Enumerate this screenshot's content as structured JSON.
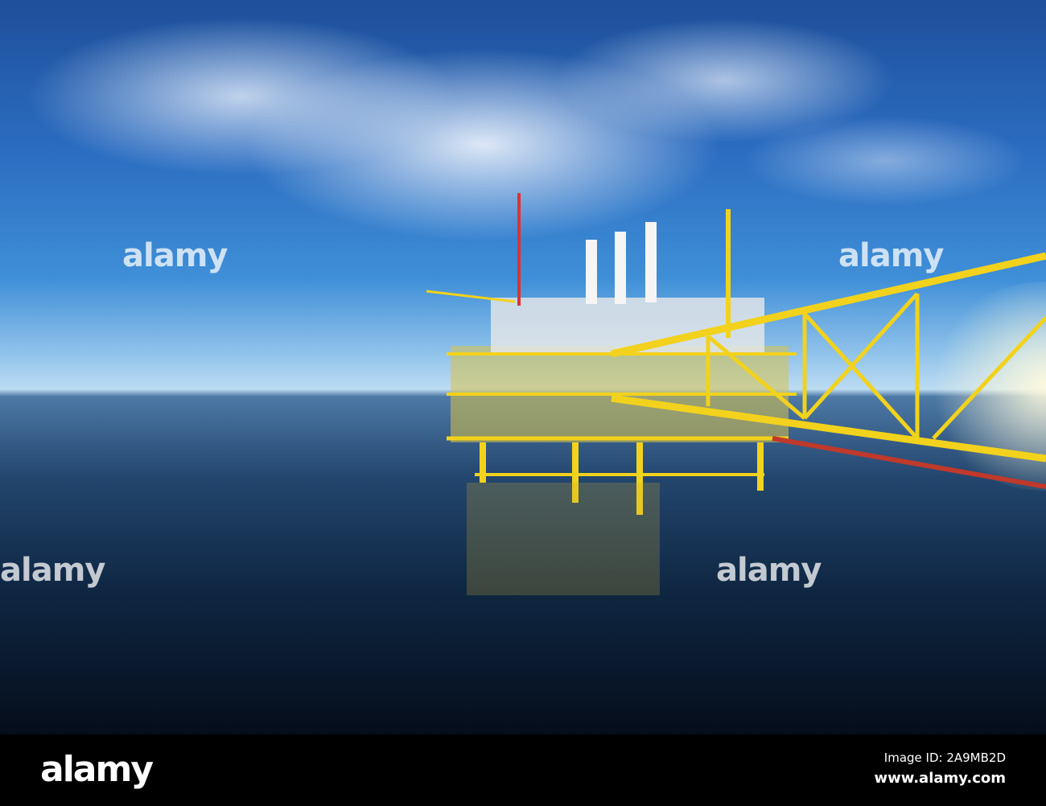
{
  "photo": {
    "subject": "offshore-oil-platform",
    "colors": {
      "sky": "#2b6cc0",
      "sea": "#0f2743",
      "structure": "#f2d21c"
    }
  },
  "watermark": {
    "text": "alamy"
  },
  "footer": {
    "logo": "alamy",
    "image_id": "Image ID: 2A9MB2D",
    "url": "www.alamy.com"
  }
}
